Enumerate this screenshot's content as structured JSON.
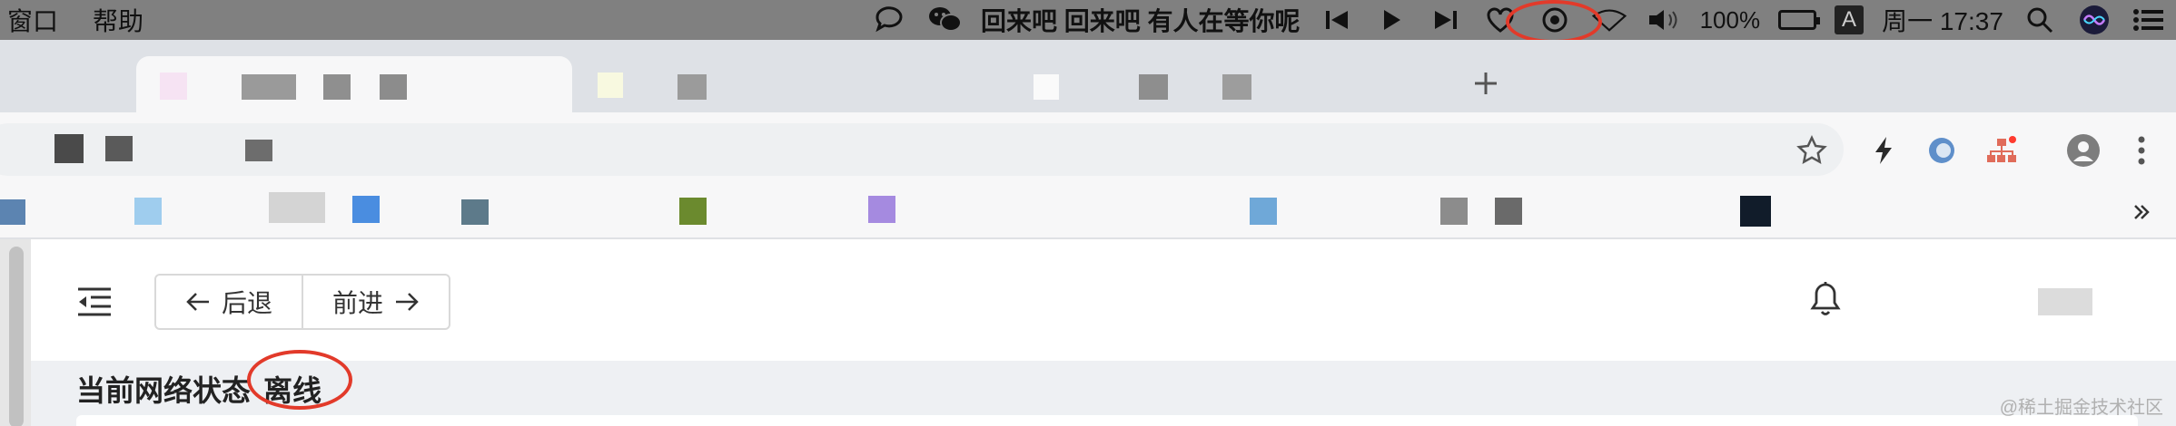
{
  "menubar": {
    "menus": [
      "窗口",
      "帮助"
    ],
    "now_playing": "回来吧 回来吧 有人在等你呢",
    "battery": "100%",
    "input_method": "A",
    "clock": "周一 17:37"
  },
  "page": {
    "nav": {
      "back_label": "后退",
      "forward_label": "前进"
    },
    "status_label": "当前网络状态",
    "status_value": "离线"
  },
  "watermark": "@稀土掘金技术社区",
  "colors": {
    "annotation_red": "#e23a2a",
    "menubar_bg": "#808080",
    "page_bg": "#eef0f3",
    "topbar_bg": "#ffffff"
  },
  "icons": [
    "wechat-icon",
    "prev-track-icon",
    "play-icon",
    "next-track-icon",
    "heart-icon",
    "wifi-icon",
    "volume-icon",
    "battery-icon",
    "search-icon",
    "siri-icon",
    "control-center-icon",
    "new-tab-icon",
    "star-icon",
    "bolt-icon",
    "profile-icon",
    "more-icon",
    "chevron-double-right-icon",
    "menu-toggle-icon",
    "arrow-left-icon",
    "arrow-right-icon",
    "bell-icon"
  ]
}
